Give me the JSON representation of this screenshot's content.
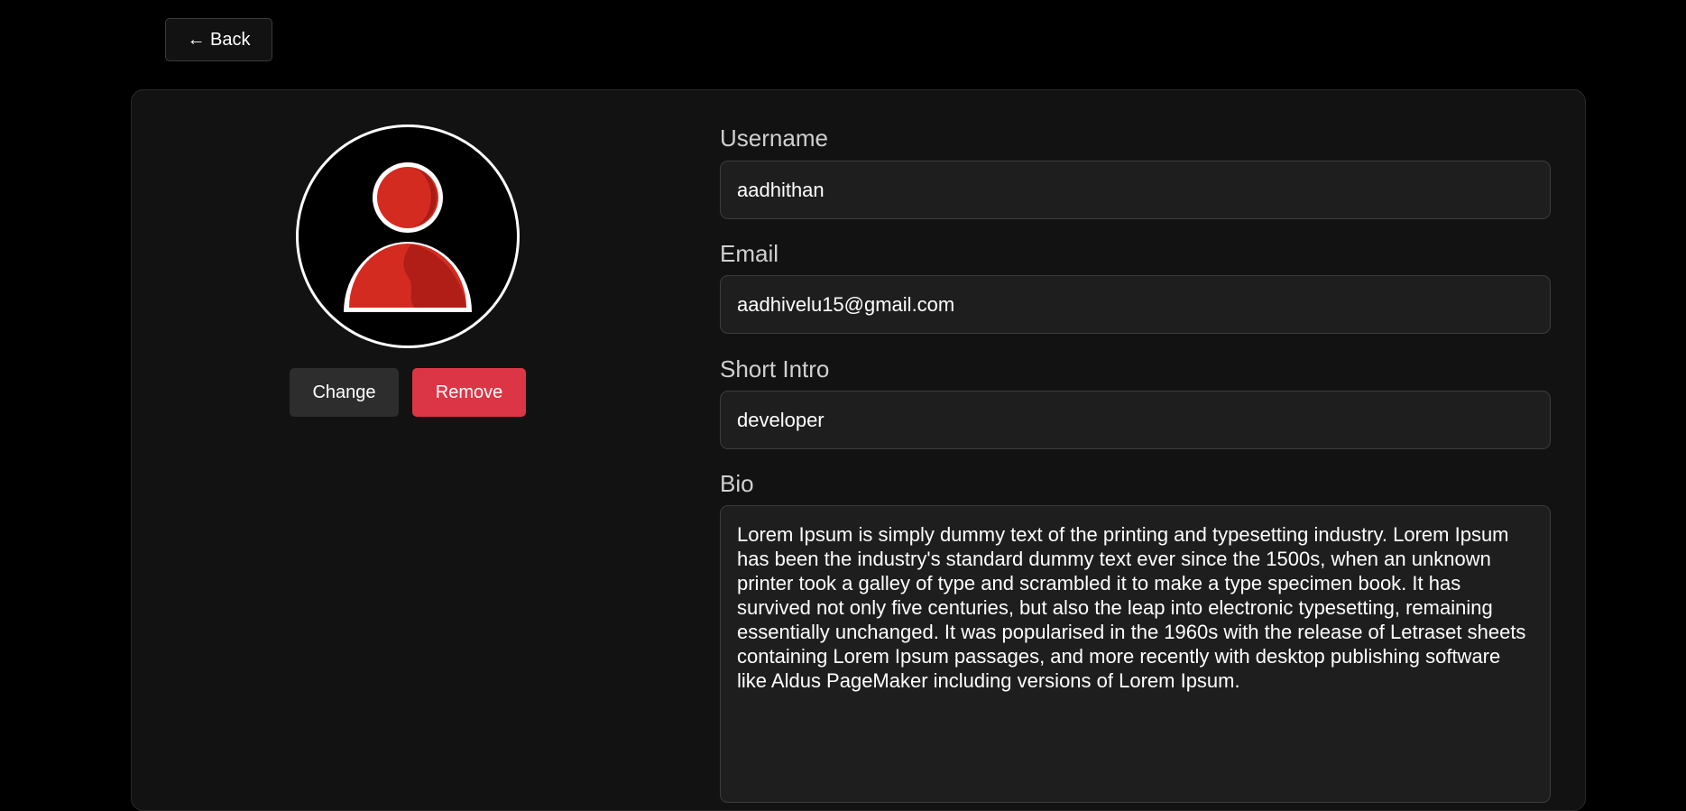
{
  "nav": {
    "back_label": "← Back"
  },
  "profile": {
    "avatar_icon": "user-silhouette-icon",
    "change_label": "Change",
    "remove_label": "Remove"
  },
  "form": {
    "username": {
      "label": "Username",
      "value": "aadhithan"
    },
    "email": {
      "label": "Email",
      "value": "aadhivelu15@gmail.com"
    },
    "short_intro": {
      "label": "Short Intro",
      "value": "developer"
    },
    "bio": {
      "label": "Bio",
      "value": "Lorem Ipsum is simply dummy text of the printing and typesetting industry. Lorem Ipsum has been the industry's standard dummy text ever since the 1500s, when an unknown printer took a galley of type and scrambled it to make a type specimen book. It has survived not only five centuries, but also the leap into electronic typesetting, remaining essentially unchanged. It was popularised in the 1960s with the release of Letraset sheets containing Lorem Ipsum passages, and more recently with desktop publishing software like Aldus PageMaker including versions of Lorem Ipsum."
    }
  },
  "colors": {
    "background": "#000000",
    "card": "#121212",
    "danger": "#dc3545",
    "avatar_red": "#d42b20"
  }
}
